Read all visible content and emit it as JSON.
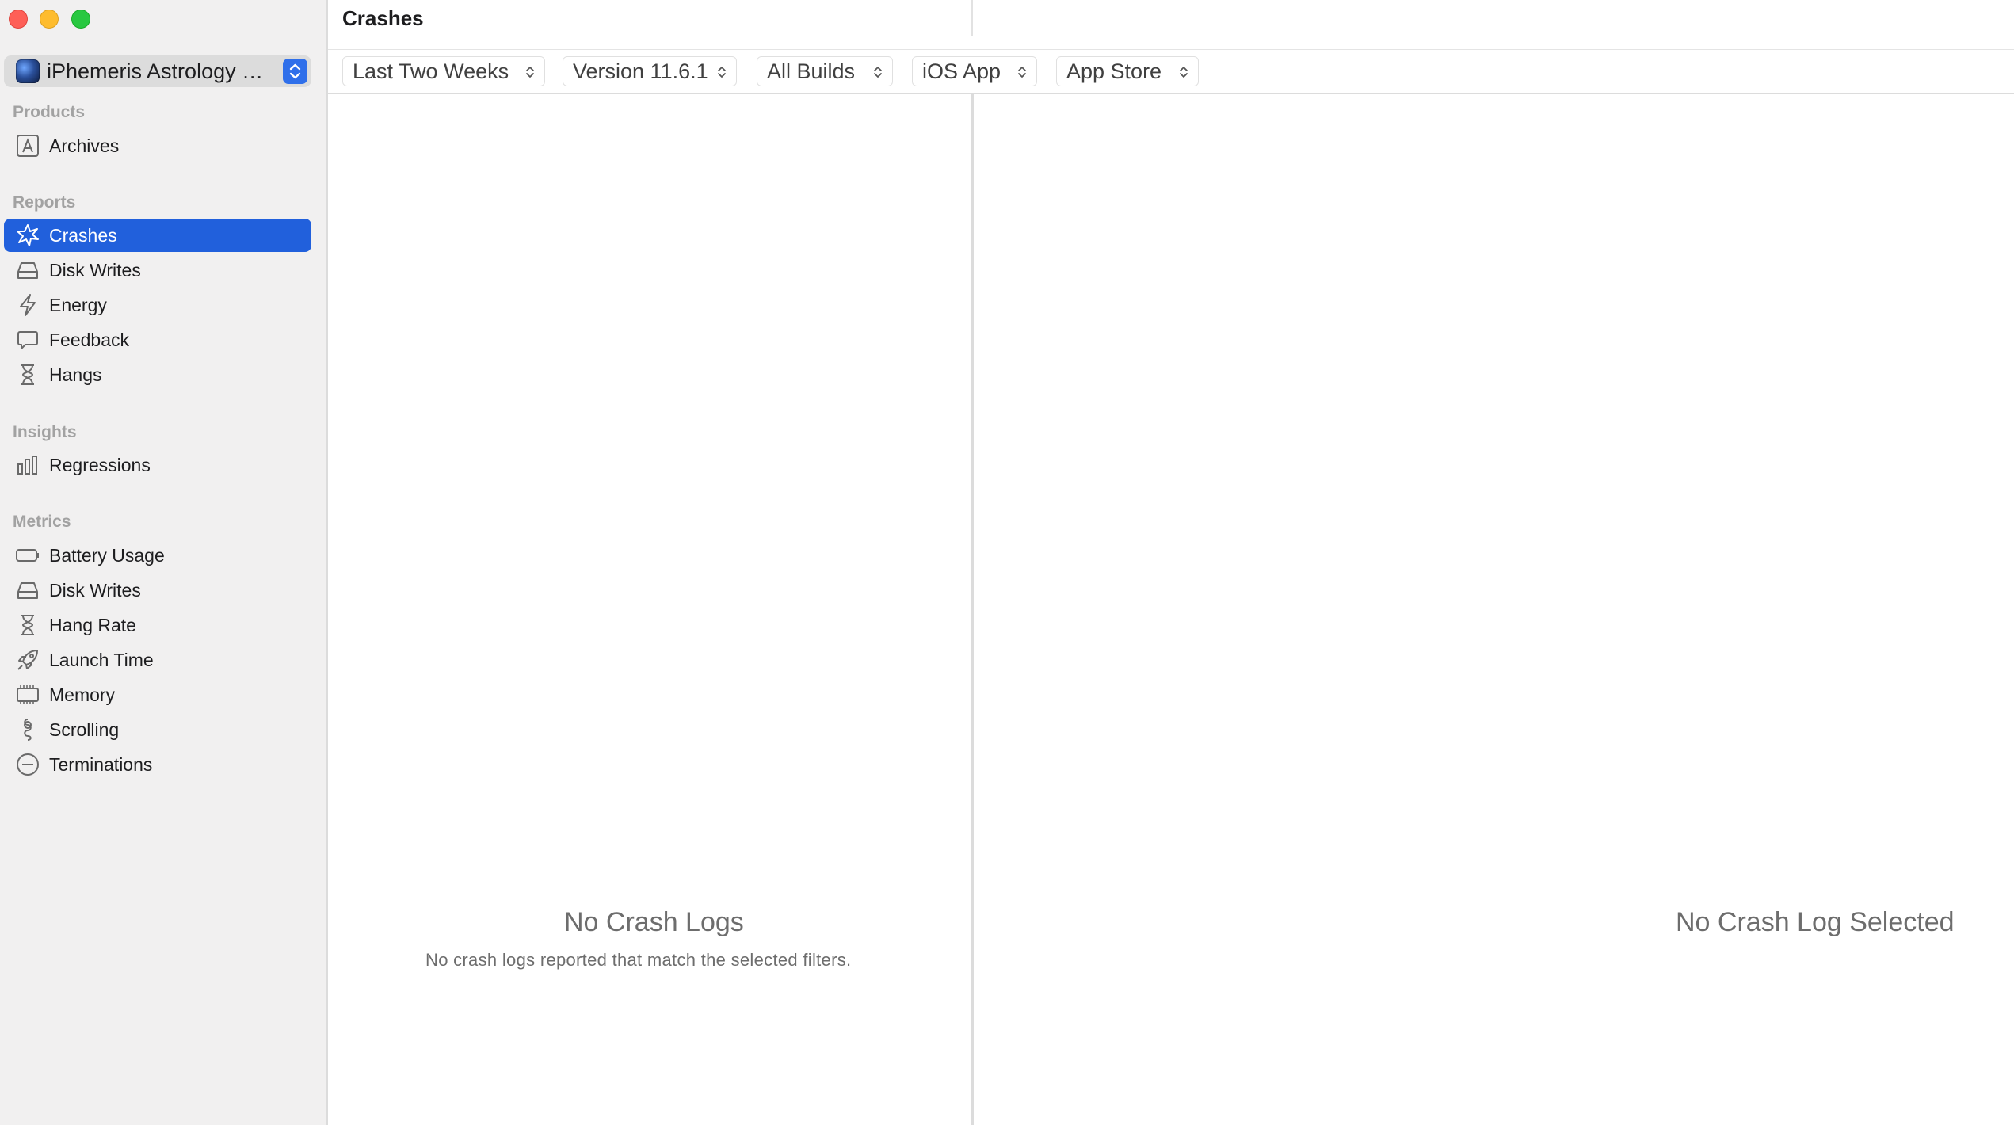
{
  "app_picker": {
    "name": "iPhemeris Astrology C..."
  },
  "sidebar": {
    "sections": {
      "products": "Products",
      "reports": "Reports",
      "insights": "Insights",
      "metrics": "Metrics"
    },
    "products": [
      {
        "label": "Archives",
        "icon": "archive-icon"
      }
    ],
    "reports": [
      {
        "label": "Crashes",
        "icon": "crash-burst-icon",
        "selected": true
      },
      {
        "label": "Disk Writes",
        "icon": "disk-drive-icon"
      },
      {
        "label": "Energy",
        "icon": "bolt-icon"
      },
      {
        "label": "Feedback",
        "icon": "speech-bubble-icon"
      },
      {
        "label": "Hangs",
        "icon": "hourglass-icon"
      }
    ],
    "insights": [
      {
        "label": "Regressions",
        "icon": "bar-chart-icon"
      }
    ],
    "metrics": [
      {
        "label": "Battery Usage",
        "icon": "battery-icon"
      },
      {
        "label": "Disk Writes",
        "icon": "disk-drive-icon"
      },
      {
        "label": "Hang Rate",
        "icon": "hourglass-icon"
      },
      {
        "label": "Launch Time",
        "icon": "rocket-icon"
      },
      {
        "label": "Memory",
        "icon": "memory-chip-icon"
      },
      {
        "label": "Scrolling",
        "icon": "scroll-icon"
      },
      {
        "label": "Terminations",
        "icon": "minus-circle-icon"
      }
    ]
  },
  "main": {
    "title": "Crashes",
    "filters": {
      "period": "Last Two Weeks",
      "version": "Version 11.6.1",
      "builds": "All Builds",
      "platform": "iOS App",
      "distribution": "App Store"
    },
    "list_empty": {
      "title": "No Crash Logs",
      "subtitle": "No crash logs reported that match the selected filters."
    },
    "detail_empty": {
      "title": "No Crash Log Selected"
    }
  },
  "colors": {
    "accent": "#2160dc",
    "sidebar_bg": "#f1f0f0",
    "muted_text": "#6d6d6d"
  }
}
